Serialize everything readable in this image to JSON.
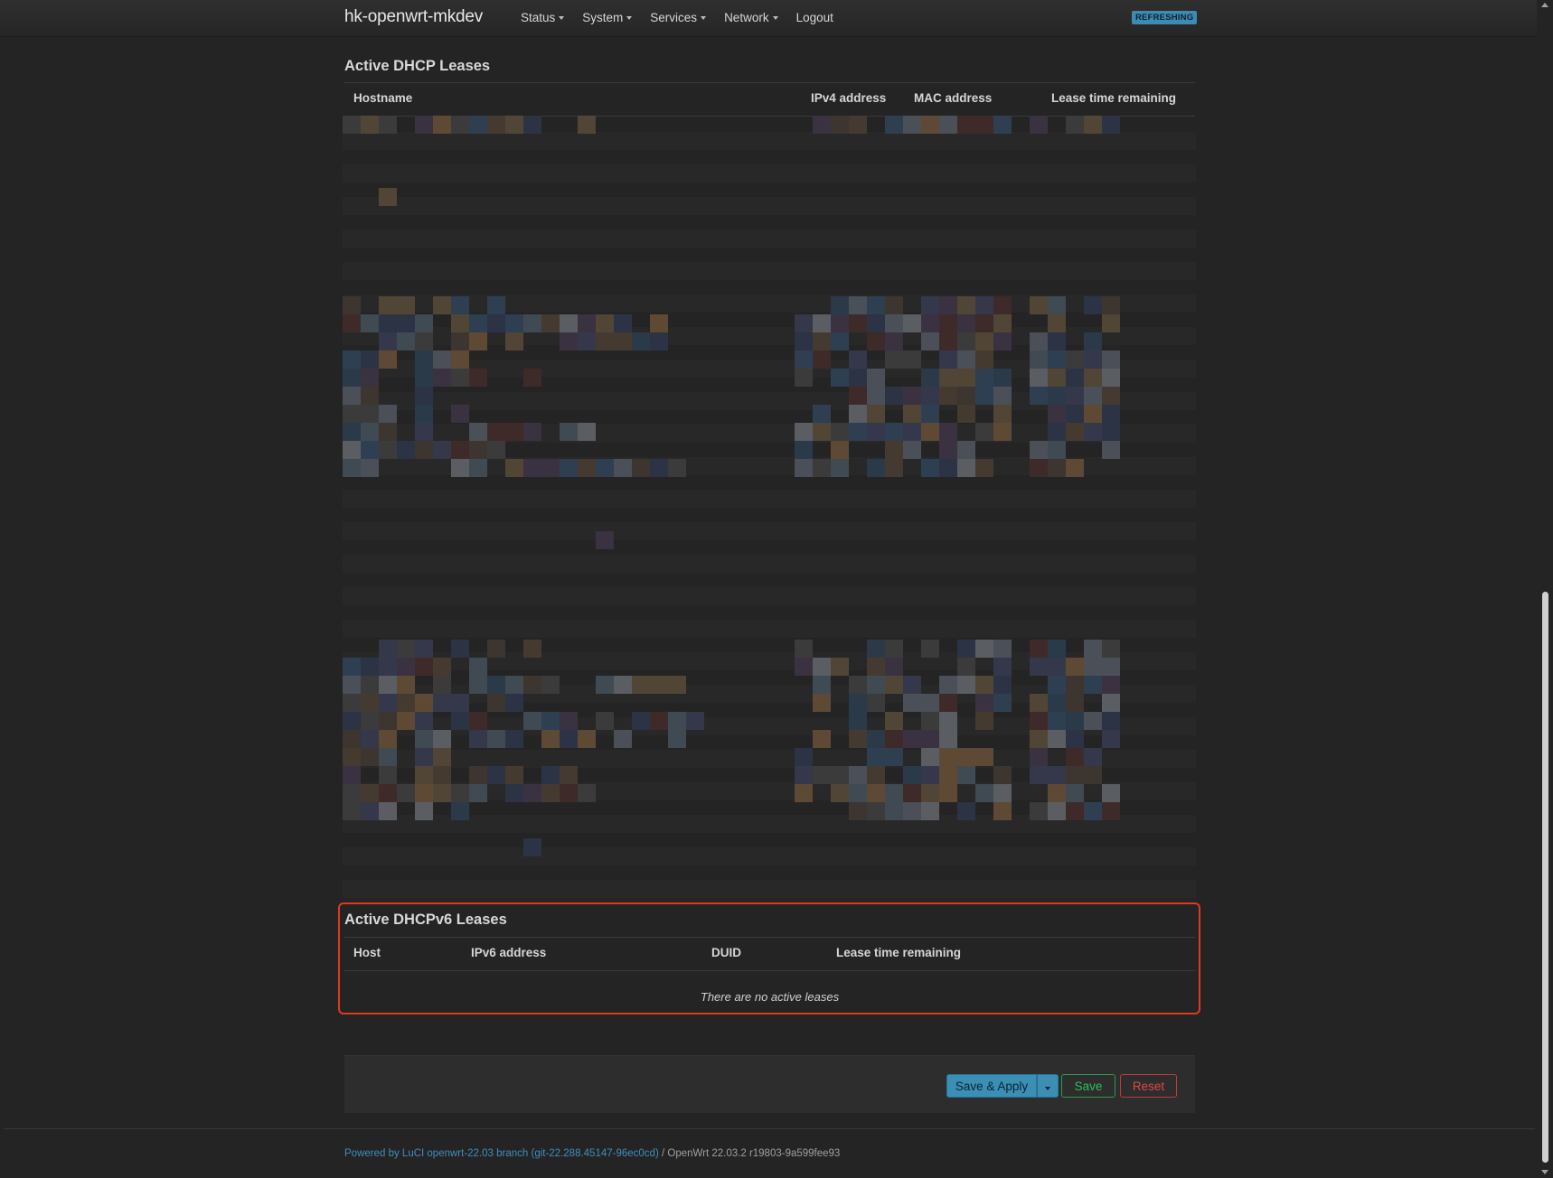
{
  "header": {
    "brand": "hk-openwrt-mkdev",
    "nav": [
      {
        "label": "Status",
        "has_dropdown": true
      },
      {
        "label": "System",
        "has_dropdown": true
      },
      {
        "label": "Services",
        "has_dropdown": true
      },
      {
        "label": "Network",
        "has_dropdown": true
      },
      {
        "label": "Logout",
        "has_dropdown": false
      }
    ],
    "badge": "REFRESHING"
  },
  "dhcp": {
    "title": "Active DHCP Leases",
    "columns": {
      "hostname": "Hostname",
      "ipv4": "IPv4 address",
      "mac": "MAC address",
      "lease": "Lease time remaining"
    }
  },
  "dhcpv6": {
    "title": "Active DHCPv6 Leases",
    "columns": {
      "host": "Host",
      "ipv6": "IPv6 address",
      "duid": "DUID",
      "lease": "Lease time remaining"
    },
    "empty_message": "There are no active leases"
  },
  "actions": {
    "save_apply": "Save & Apply",
    "save": "Save",
    "reset": "Reset"
  },
  "footer": {
    "link": "Powered by LuCI openwrt-22.03 branch (git-22.288.45147-96ec0cd)",
    "separator": " / ",
    "version": "OpenWrt 22.03.2 r19803-9a599fee93"
  },
  "colors": {
    "highlight": "#e0391f",
    "primary_button": "#3b8fb5",
    "save_button": "#2fbf55",
    "reset_button": "#e04646"
  }
}
